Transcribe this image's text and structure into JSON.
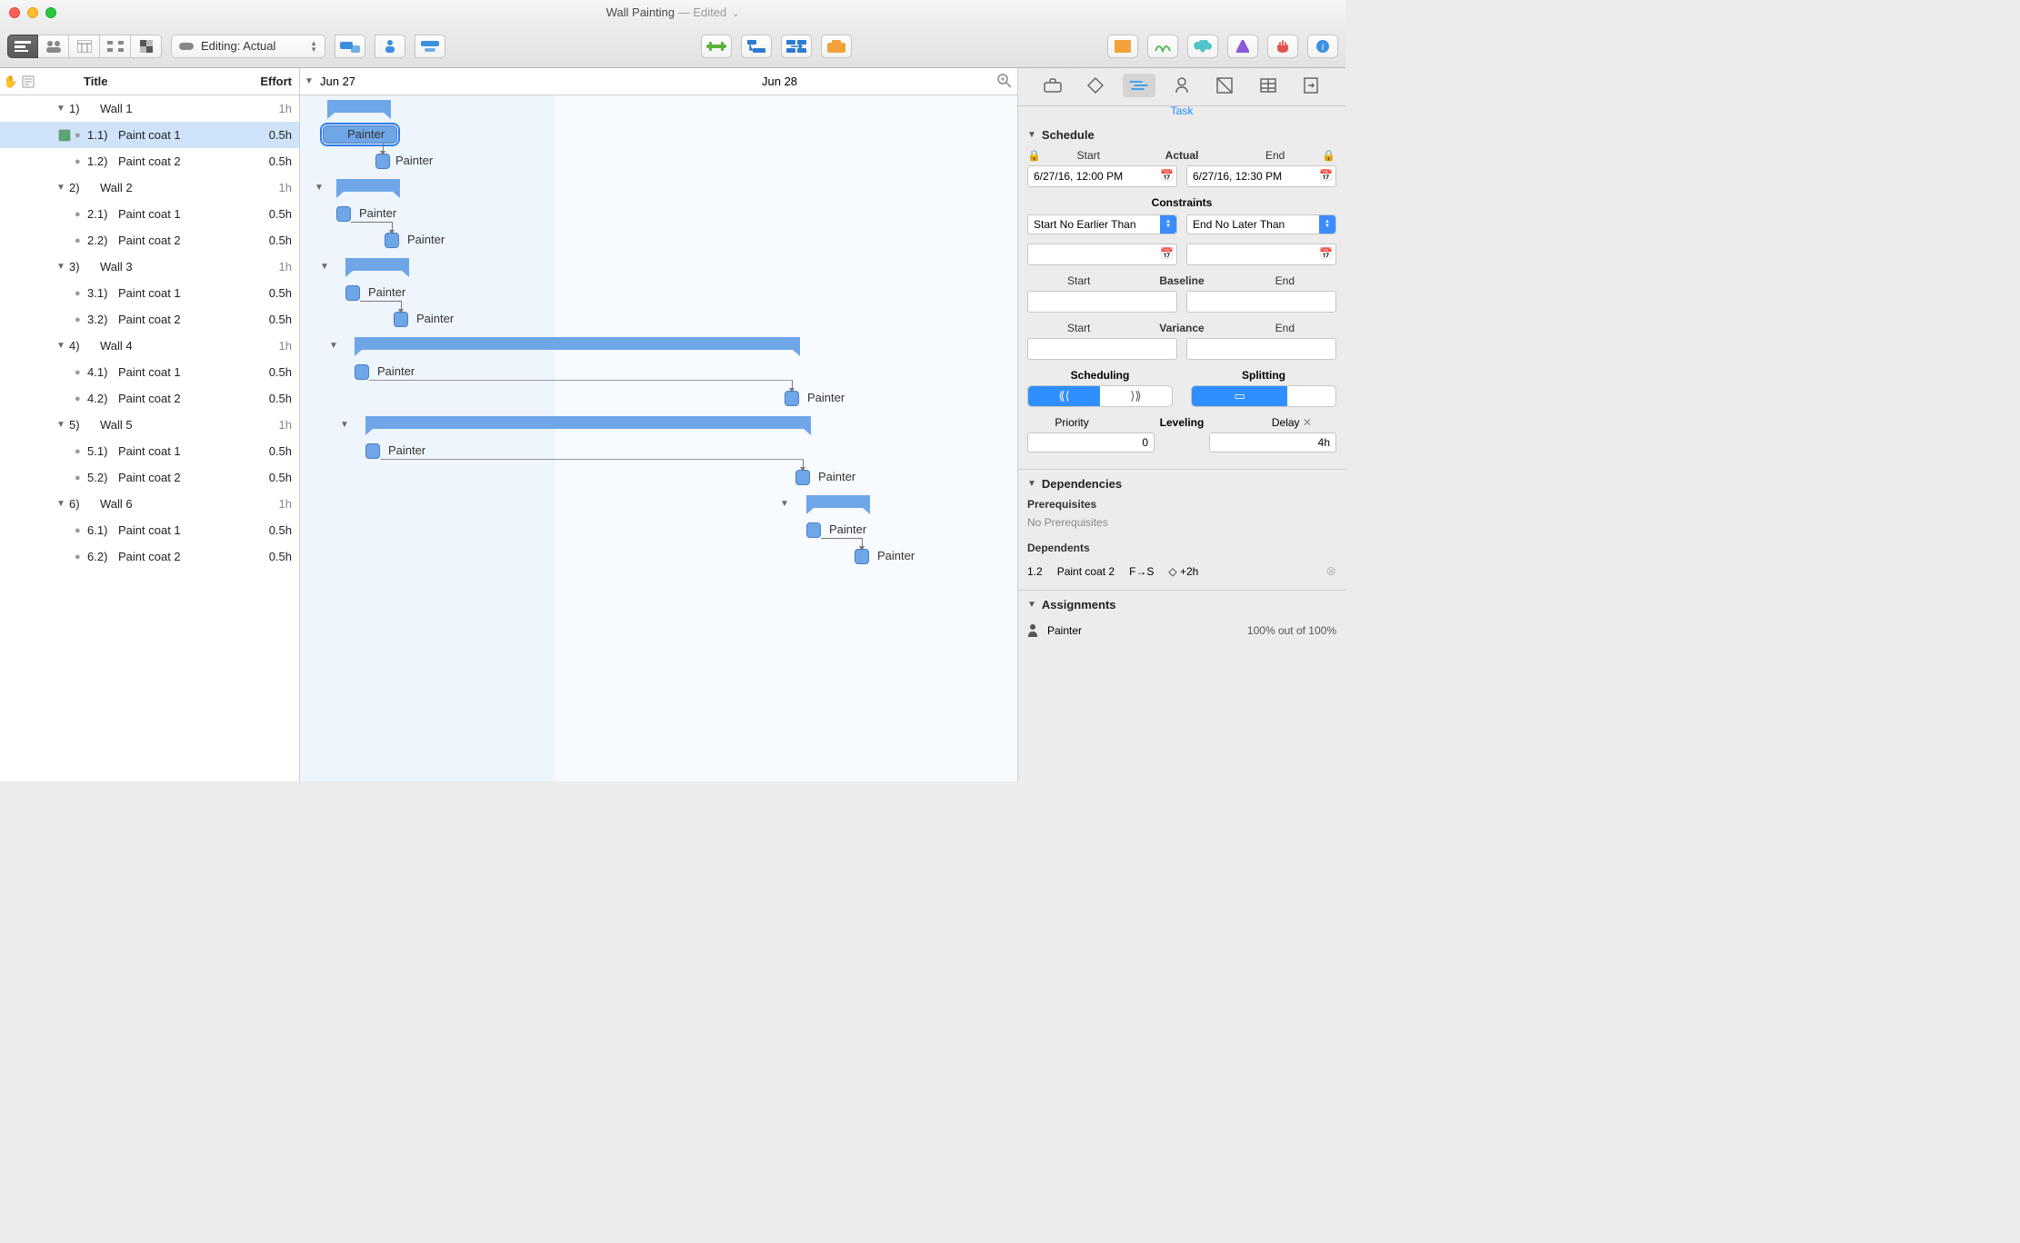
{
  "window": {
    "title": "Wall Painting",
    "edited_suffix": " — Edited"
  },
  "toolbar": {
    "editing_label": "Editing: Actual"
  },
  "outline": {
    "columns": {
      "title": "Title",
      "effort": "Effort"
    },
    "rows": [
      {
        "depth": 0,
        "type": "parent",
        "num": "1)",
        "text": "Wall 1",
        "effort": "1h"
      },
      {
        "depth": 1,
        "type": "task",
        "num": "1.1)",
        "text": "Paint coat 1",
        "effort": "0.5h",
        "selected": true
      },
      {
        "depth": 1,
        "type": "task",
        "num": "1.2)",
        "text": "Paint coat 2",
        "effort": "0.5h"
      },
      {
        "depth": 0,
        "type": "parent",
        "num": "2)",
        "text": "Wall 2",
        "effort": "1h"
      },
      {
        "depth": 1,
        "type": "task",
        "num": "2.1)",
        "text": "Paint coat 1",
        "effort": "0.5h"
      },
      {
        "depth": 1,
        "type": "task",
        "num": "2.2)",
        "text": "Paint coat 2",
        "effort": "0.5h"
      },
      {
        "depth": 0,
        "type": "parent",
        "num": "3)",
        "text": "Wall 3",
        "effort": "1h"
      },
      {
        "depth": 1,
        "type": "task",
        "num": "3.1)",
        "text": "Paint coat 1",
        "effort": "0.5h"
      },
      {
        "depth": 1,
        "type": "task",
        "num": "3.2)",
        "text": "Paint coat 2",
        "effort": "0.5h"
      },
      {
        "depth": 0,
        "type": "parent",
        "num": "4)",
        "text": "Wall 4",
        "effort": "1h"
      },
      {
        "depth": 1,
        "type": "task",
        "num": "4.1)",
        "text": "Paint coat 1",
        "effort": "0.5h"
      },
      {
        "depth": 1,
        "type": "task",
        "num": "4.2)",
        "text": "Paint coat 2",
        "effort": "0.5h"
      },
      {
        "depth": 0,
        "type": "parent",
        "num": "5)",
        "text": "Wall 5",
        "effort": "1h"
      },
      {
        "depth": 1,
        "type": "task",
        "num": "5.1)",
        "text": "Paint coat 1",
        "effort": "0.5h"
      },
      {
        "depth": 1,
        "type": "task",
        "num": "5.2)",
        "text": "Paint coat 2",
        "effort": "0.5h"
      },
      {
        "depth": 0,
        "type": "parent",
        "num": "6)",
        "text": "Wall 6",
        "effort": "1h"
      },
      {
        "depth": 1,
        "type": "task",
        "num": "6.1)",
        "text": "Paint coat 1",
        "effort": "0.5h"
      },
      {
        "depth": 1,
        "type": "task",
        "num": "6.2)",
        "text": "Paint coat 2",
        "effort": "0.5h"
      }
    ]
  },
  "gantt": {
    "dates": {
      "d1": "Jun 27",
      "d2": "Jun 28"
    },
    "resource": "Painter"
  },
  "inspector": {
    "tab_label": "Task",
    "schedule": {
      "title": "Schedule",
      "start_label": "Start",
      "actual_label": "Actual",
      "end_label": "End",
      "start_value": "6/27/16, 12:00 PM",
      "end_value": "6/27/16, 12:30 PM",
      "constraints_title": "Constraints",
      "constraint_start": "Start No Earlier Than",
      "constraint_end": "End No Later Than",
      "baseline_title": "Baseline",
      "variance_title": "Variance",
      "scheduling_title": "Scheduling",
      "splitting_title": "Splitting",
      "priority_label": "Priority",
      "leveling_label": "Leveling",
      "delay_label": "Delay",
      "priority_value": "0",
      "delay_value": "4h"
    },
    "dependencies": {
      "title": "Dependencies",
      "prereq_title": "Prerequisites",
      "prereq_none": "No Prerequisites",
      "dep_title": "Dependents",
      "dep_row": {
        "num": "1.2",
        "name": "Paint coat 2",
        "type": "F→S",
        "lag": "+2h"
      }
    },
    "assignments": {
      "title": "Assignments",
      "row": {
        "name": "Painter",
        "pct": "100% out of 100%"
      }
    }
  }
}
